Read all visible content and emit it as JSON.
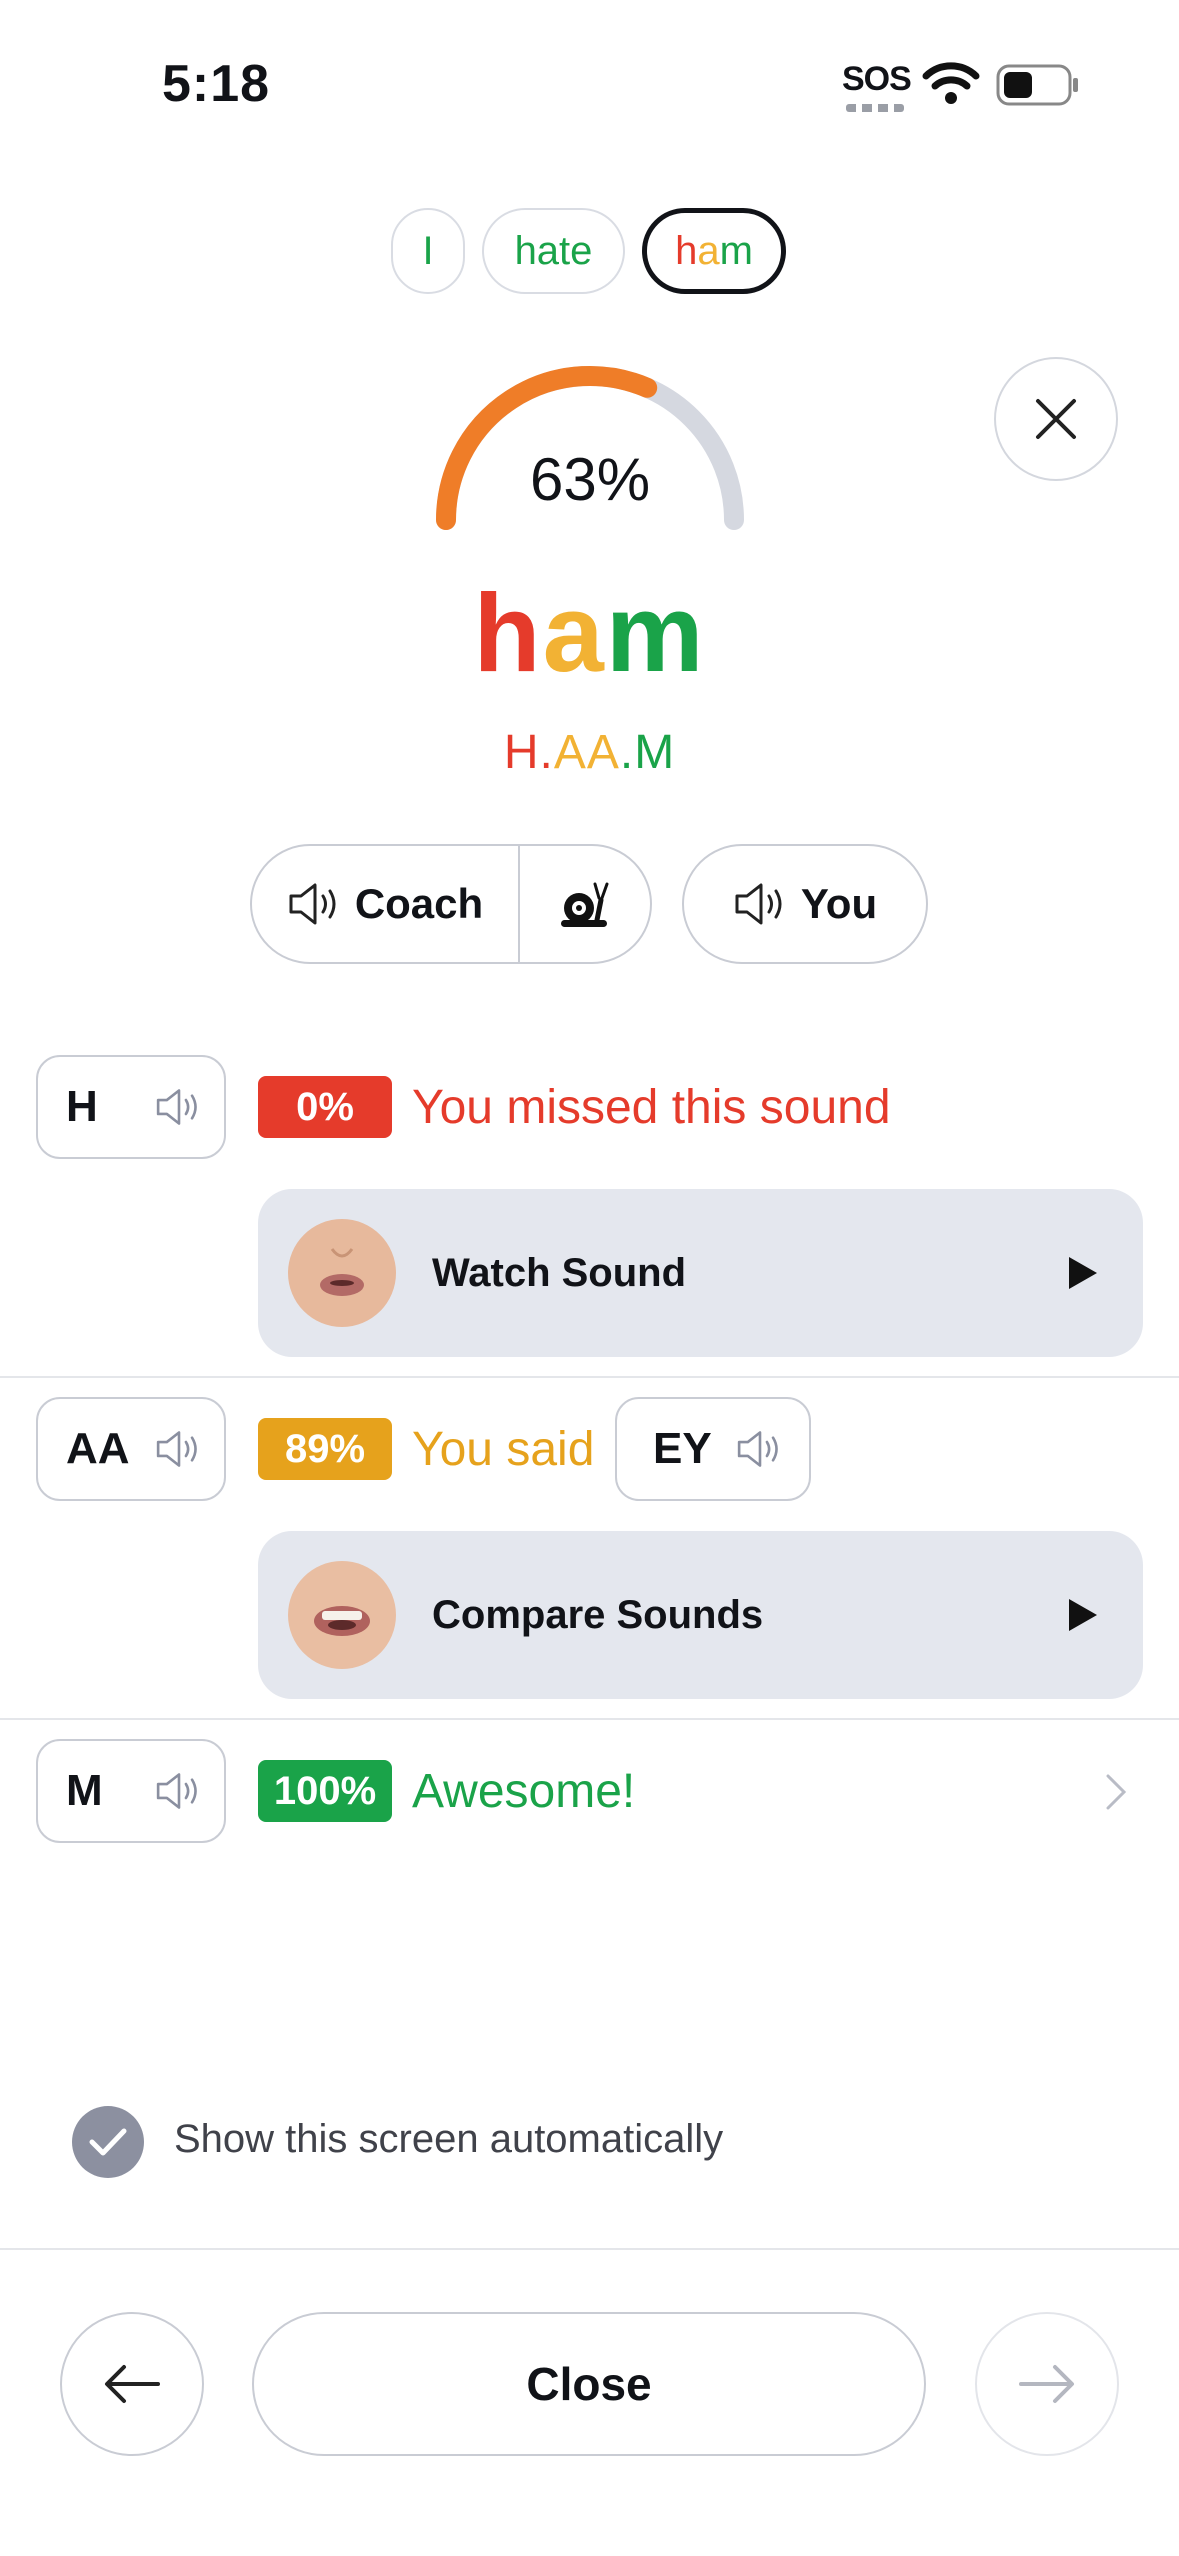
{
  "status_bar": {
    "time": "5:18",
    "sos": "SOS"
  },
  "words": [
    {
      "text": "I",
      "color": "#1aa349"
    },
    {
      "text": "hate",
      "color": "#1aa349"
    },
    {
      "text": "ham",
      "active": true,
      "letters": [
        "h",
        "a",
        "m"
      ],
      "colors": [
        "#e53b2b",
        "#f2b234",
        "#1aa349"
      ]
    }
  ],
  "score": {
    "value": 63,
    "label": "63%",
    "color": "#ef7d28",
    "track": "#d5d8e0"
  },
  "current_word": {
    "letters": [
      "h",
      "a",
      "m"
    ]
  },
  "phonetic": {
    "parts": [
      "H",
      ".",
      "AA",
      ".",
      "M"
    ]
  },
  "audio": {
    "coach_label": "Coach",
    "you_label": "You"
  },
  "sounds": [
    {
      "phoneme": "H",
      "badge": "0%",
      "badge_color": "#e53b2b",
      "message": "You missed this sound",
      "action": "Watch Sound"
    },
    {
      "phoneme": "AA",
      "badge": "89%",
      "badge_color": "#e6a21c",
      "message": "You said",
      "said": "EY",
      "action": "Compare Sounds"
    },
    {
      "phoneme": "M",
      "badge": "100%",
      "badge_color": "#1aa349",
      "message": "Awesome!"
    }
  ],
  "settings": {
    "auto_show_label": "Show this screen automatically",
    "checked": true
  },
  "footer": {
    "close_label": "Close"
  }
}
